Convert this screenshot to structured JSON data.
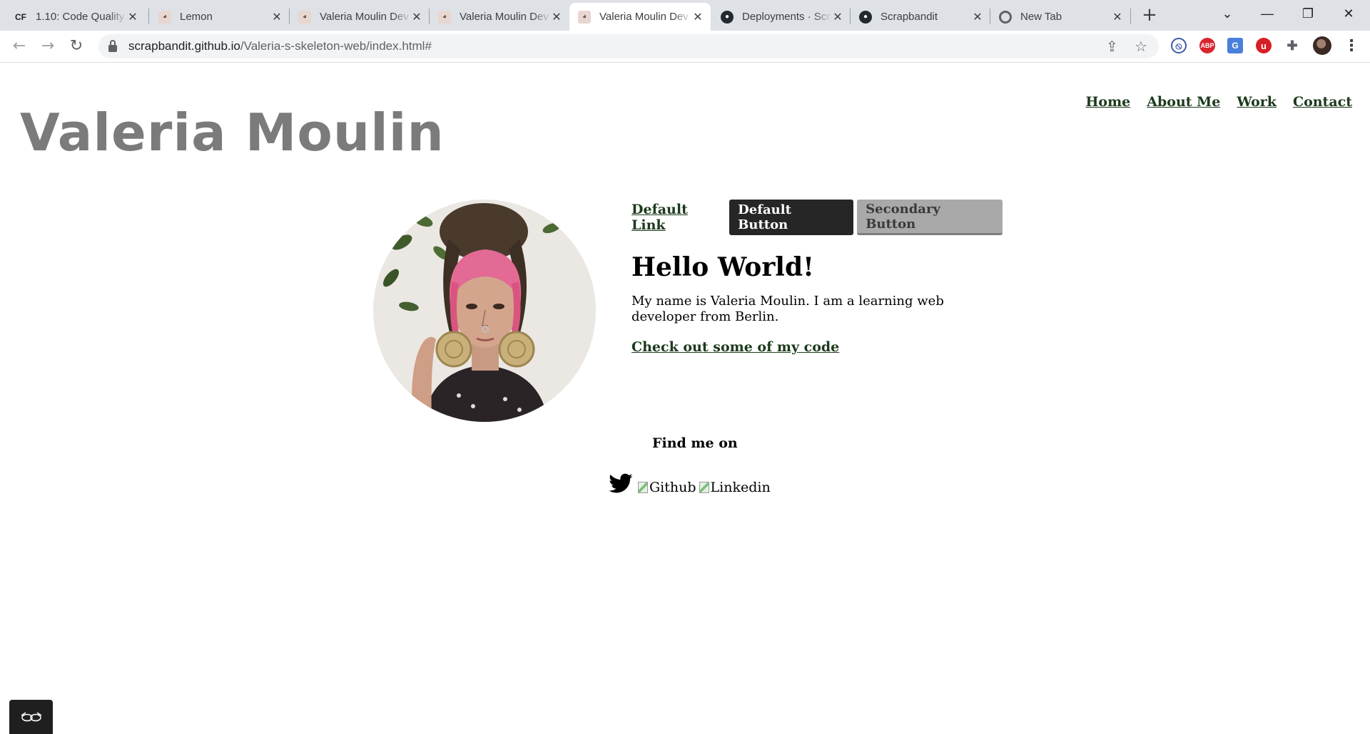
{
  "browser": {
    "tabs": [
      {
        "favicon": "CF",
        "favicon_kind": "cf-logo",
        "title": "1.10: Code Quality",
        "active": false
      },
      {
        "favicon": "cat-icon",
        "favicon_kind": "cat",
        "title": "Lemon",
        "active": false
      },
      {
        "favicon": "cat-icon",
        "favicon_kind": "cat",
        "title": "Valeria Moulin Dev",
        "active": false
      },
      {
        "favicon": "cat-icon",
        "favicon_kind": "cat",
        "title": "Valeria Moulin Dev",
        "active": false
      },
      {
        "favicon": "cat-icon",
        "favicon_kind": "cat",
        "title": "Valeria Moulin Dev",
        "active": true
      },
      {
        "favicon": "github-icon",
        "favicon_kind": "github",
        "title": "Deployments · Scrapbandit",
        "active": false
      },
      {
        "favicon": "github-icon",
        "favicon_kind": "github",
        "title": "Scrapbandit",
        "active": false
      },
      {
        "favicon": "chrome-icon",
        "favicon_kind": "chrome",
        "title": "New Tab",
        "active": false
      }
    ],
    "new_tab_glyph": "+",
    "controls": {
      "tab_search": "⌄",
      "minimize": "—",
      "restore": "❐",
      "close": "✕"
    },
    "nav": {
      "back": "←",
      "forward": "→",
      "reload": "↻"
    },
    "url": {
      "host": "scrapbandit.github.io",
      "path": "/Valeria-s-skeleton-web/index.html#"
    },
    "extensions": [
      {
        "name": "block-extension-icon",
        "label": "⦸",
        "color": "#3c5aa8"
      },
      {
        "name": "adblock-extension-icon",
        "label": "ABP",
        "color": "#d8262f"
      },
      {
        "name": "translate-extension-icon",
        "label": "G",
        "color": "#4a7fdc"
      },
      {
        "name": "ublock-extension-icon",
        "label": "u",
        "color": "#d81f26"
      },
      {
        "name": "puzzle-extension-icon",
        "label": "✚",
        "color": "#5f6368"
      }
    ],
    "menu_glyph": "⋮"
  },
  "page": {
    "site_title": "Valeria Moulin",
    "nav": [
      "Home",
      "About Me",
      "Work",
      "Contact"
    ],
    "buttons": {
      "default_link": "Default Link",
      "default_button": "Default Button",
      "secondary_button": "Secondary Button"
    },
    "heading": "Hello World!",
    "intro": "My name is Valeria Moulin. I am a learning web developer from Berlin.",
    "code_link": "Check out some of my code",
    "find_me": "Find me on",
    "social": {
      "github_alt": "Github",
      "linkedin_alt": "Linkedin"
    }
  },
  "colors": {
    "title_gray": "#7b7b7b",
    "link_green": "#1c3a1c",
    "button_dark": "#262626",
    "button_gray": "#a9a9a9",
    "pink_hair": "#e26a94"
  }
}
